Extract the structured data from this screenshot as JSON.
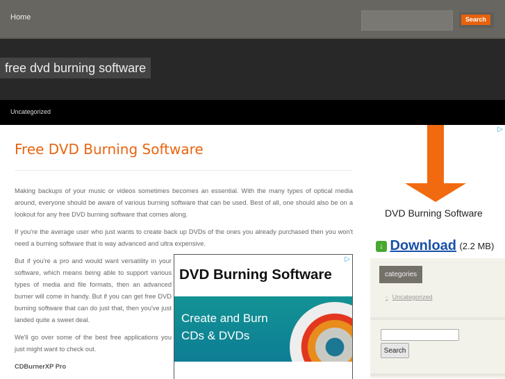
{
  "header": {
    "home": "Home",
    "search_button": "Search",
    "site_title": "free dvd burning software",
    "nav_item": "Uncategorized"
  },
  "post": {
    "title": "Free DVD Burning Software",
    "paragraphs": [
      "Making backups of your music or videos sometimes becomes an essential. With the many types of optical media around, everyone should be aware of various burning software that can be used. Best of all, one should also be on a lookout for any free DVD burning software that comes along.",
      "If you're the average user who just wants to create back up DVDs of the ones you already purchased then you won't need a burning software that is way advanced and ultra expensive.",
      "But if you're a pro and would want versatility in your software, which means being able to support various types of media and file formats, then an advanced burner will come in handy. But if you can get free DVD burning software that can do just that, then you've just landed quite a sweet deal.",
      "We'll go over some of the best free applications you just might want to check out."
    ],
    "subheading": "CDBurnerXP Pro"
  },
  "ad_inline": {
    "title": "DVD Burning Software",
    "line1": "Create and Burn",
    "line2": "CDs & DVDs"
  },
  "ad_side": {
    "name": "DVD Burning Software",
    "download": "Download",
    "size": "(2.2 MB)"
  },
  "sidebar": {
    "categories_title": "categories",
    "category": "Uncategorized",
    "search_button": "Search"
  }
}
